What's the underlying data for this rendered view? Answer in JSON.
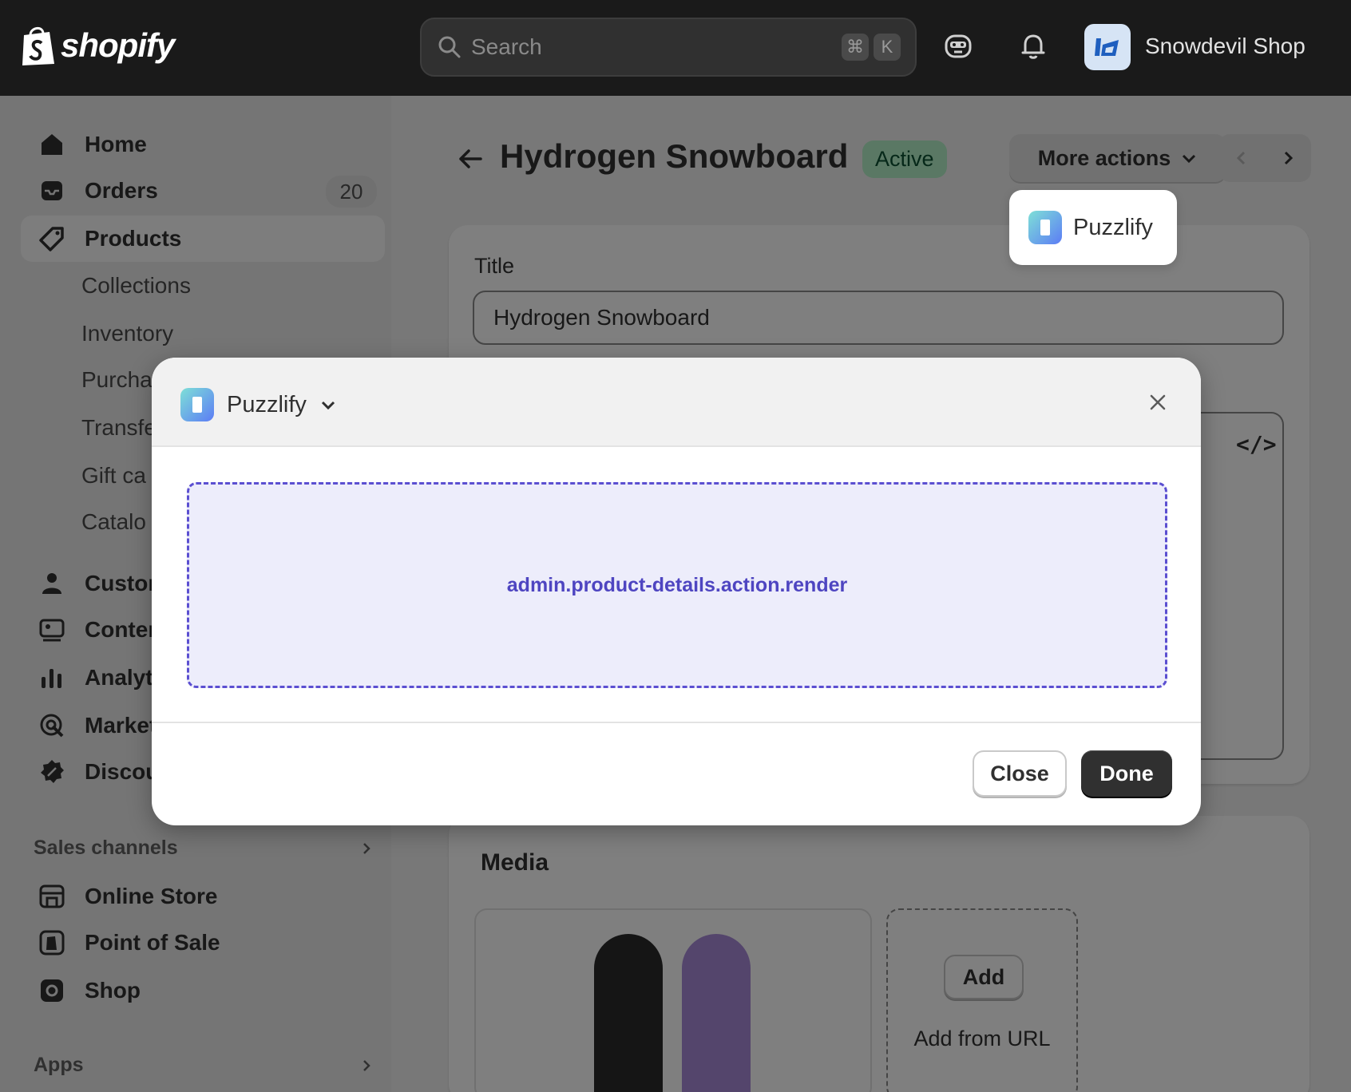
{
  "topbar": {
    "logo_text": "shopify",
    "search_placeholder": "Search",
    "shortcut_keys": [
      "⌘",
      "K"
    ],
    "store_name": "Snowdevil Shop"
  },
  "sidebar": {
    "items": [
      {
        "label": "Home",
        "icon": "home-icon"
      },
      {
        "label": "Orders",
        "icon": "inbox-icon",
        "badge": "20"
      },
      {
        "label": "Products",
        "icon": "tag-icon",
        "active": true
      }
    ],
    "sub_items": [
      "Collections",
      "Inventory",
      "Purcha",
      "Transfe",
      "Gift ca",
      "Catalo"
    ],
    "items2": [
      {
        "label": "Custor",
        "icon": "person-icon"
      },
      {
        "label": "Conter",
        "icon": "content-icon"
      },
      {
        "label": "Analyti",
        "icon": "chart-icon"
      },
      {
        "label": "Market",
        "icon": "target-icon"
      },
      {
        "label": "Discou",
        "icon": "discount-icon"
      }
    ],
    "sales_channels_label": "Sales channels",
    "channels": [
      {
        "label": "Online Store",
        "icon": "store-icon"
      },
      {
        "label": "Point of Sale",
        "icon": "pos-icon"
      },
      {
        "label": "Shop",
        "icon": "shop-icon"
      }
    ],
    "apps_label": "Apps"
  },
  "page": {
    "title": "Hydrogen Snowboard",
    "status": "Active",
    "more_actions_label": "More actions",
    "dropdown_item": "Puzzlify",
    "title_field_label": "Title",
    "title_field_value": "Hydrogen Snowboard",
    "code_toggle": "</>",
    "media_title": "Media",
    "add_button": "Add",
    "add_from_url": "Add from URL"
  },
  "modal": {
    "app_name": "Puzzlify",
    "placeholder_text": "admin.product-details.action.render",
    "close_label": "Close",
    "done_label": "Done"
  },
  "colors": {
    "topbar": "#1a1a1a",
    "status_badge_bg": "#b4f0c8",
    "extension_border": "#5b4fd1",
    "extension_bg": "#ededfb",
    "primary_button": "#303030"
  }
}
